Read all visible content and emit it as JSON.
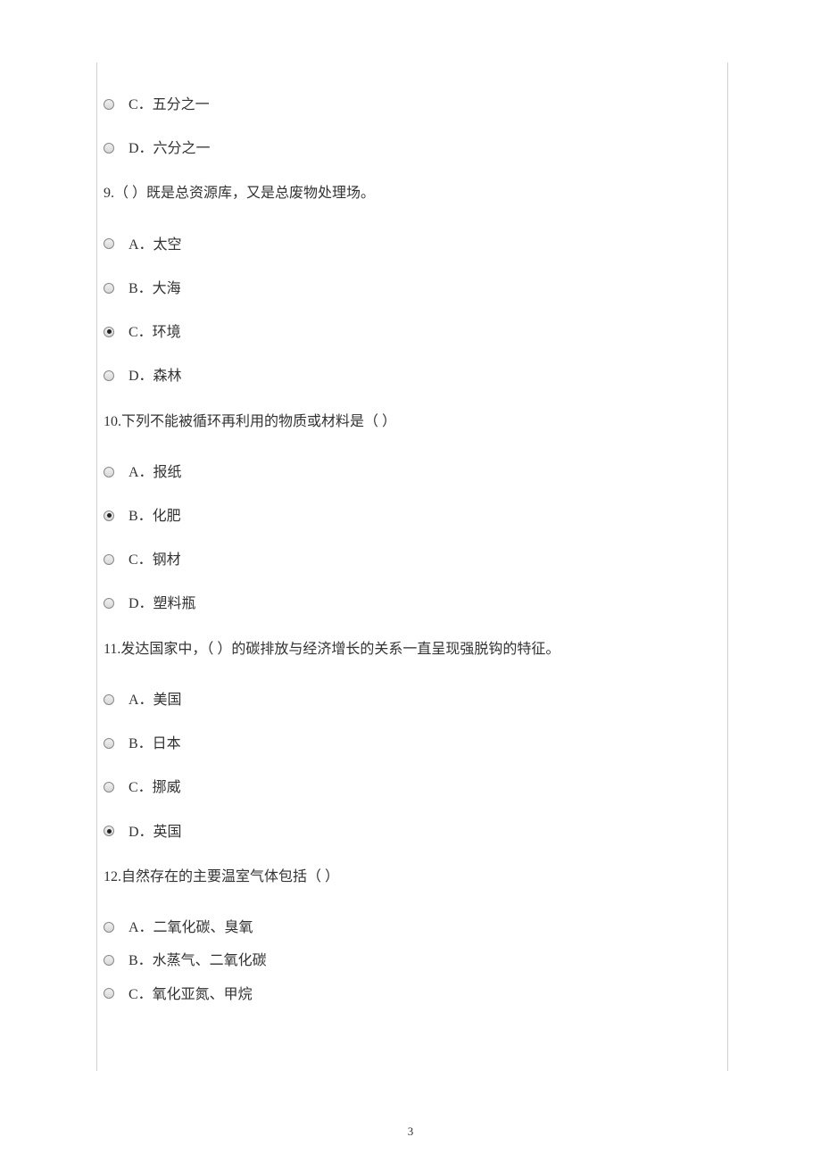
{
  "page_number": "3",
  "orphan_options": {
    "c": "C．五分之一",
    "d": "D．六分之一"
  },
  "questions": [
    {
      "prompt": "9.（  ）既是总资源库，又是总废物处理场。",
      "options": [
        {
          "label": "A．太空",
          "selected": false
        },
        {
          "label": "B．大海",
          "selected": false
        },
        {
          "label": "C．环境",
          "selected": true
        },
        {
          "label": "D．森林",
          "selected": false
        }
      ]
    },
    {
      "prompt": "10.下列不能被循环再利用的物质或材料是（  ）",
      "options": [
        {
          "label": "A．报纸",
          "selected": false
        },
        {
          "label": "B．化肥",
          "selected": true
        },
        {
          "label": "C．钢材",
          "selected": false
        },
        {
          "label": "D．塑料瓶",
          "selected": false
        }
      ]
    },
    {
      "prompt": "11.发达国家中，（  ）的碳排放与经济增长的关系一直呈现强脱钩的特征。",
      "options": [
        {
          "label": "A．美国",
          "selected": false
        },
        {
          "label": "B．日本",
          "selected": false
        },
        {
          "label": "C．挪威",
          "selected": false
        },
        {
          "label": "D．英国",
          "selected": true
        }
      ]
    },
    {
      "prompt": "12.自然存在的主要温室气体包括（  ）",
      "options": [
        {
          "label": "A．二氧化碳、臭氧",
          "selected": false
        },
        {
          "label": "B．水蒸气、二氧化碳",
          "selected": false
        },
        {
          "label": "C．氧化亚氮、甲烷",
          "selected": false
        }
      ]
    }
  ]
}
